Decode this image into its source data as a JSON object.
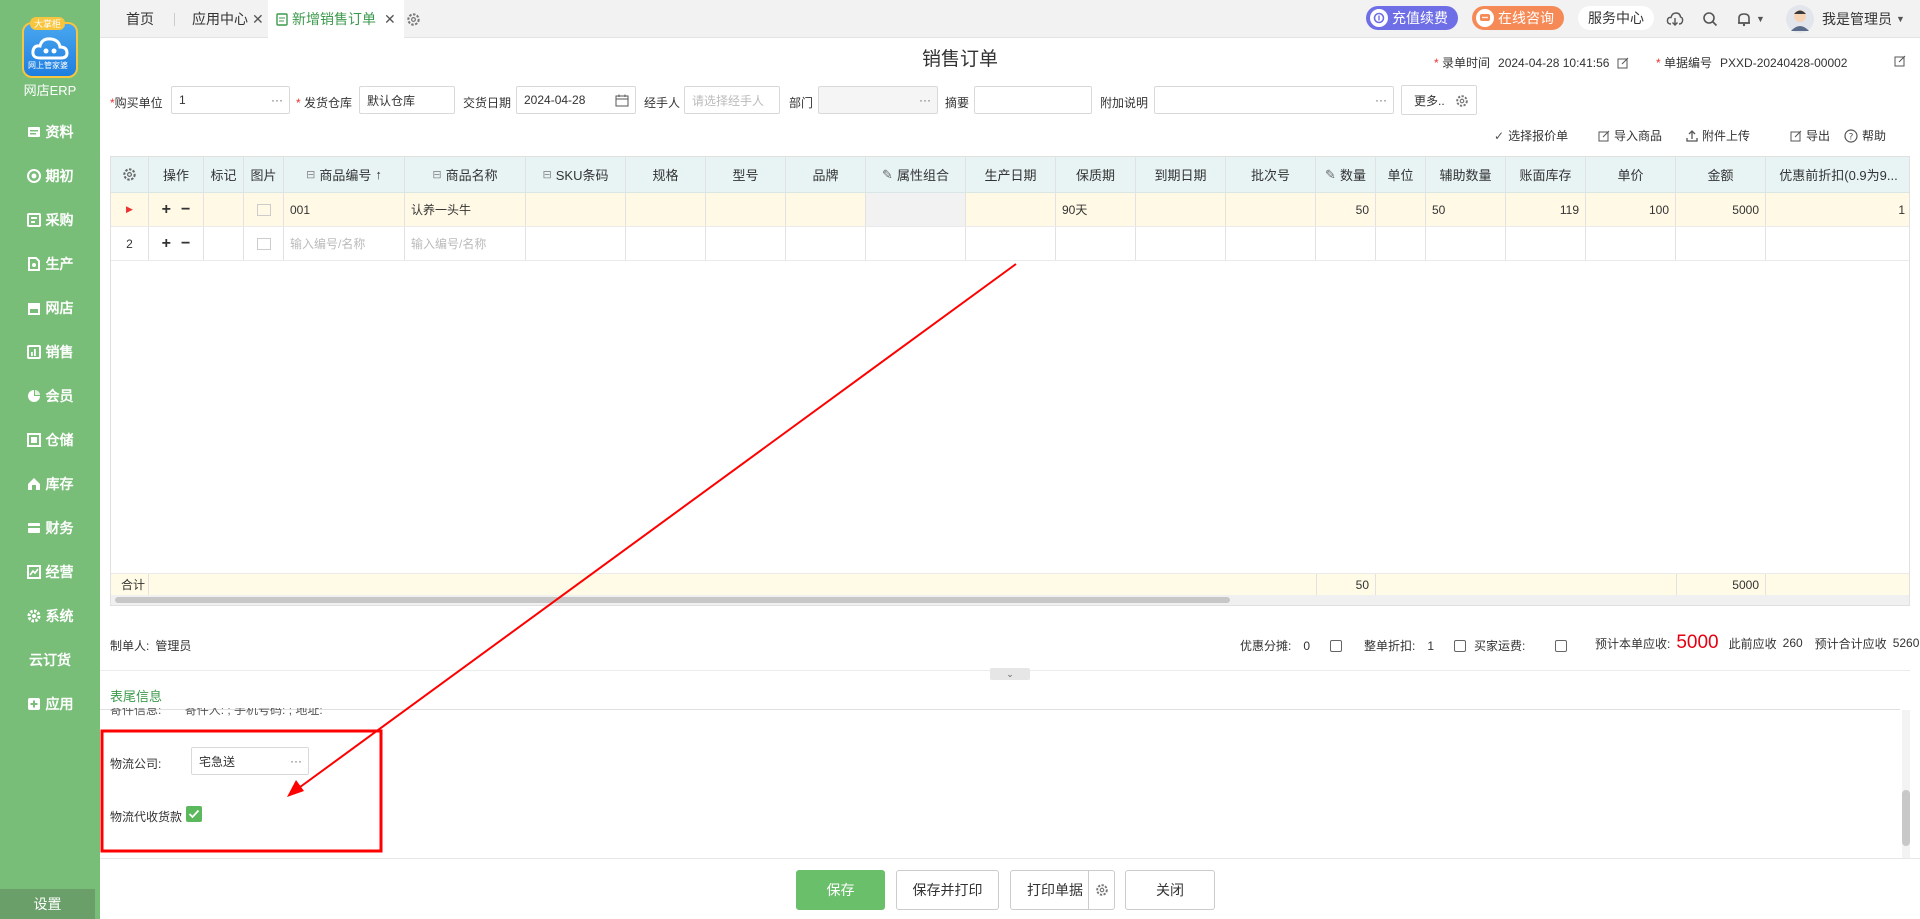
{
  "sidebar": {
    "logo_badge": "大掌柜",
    "logo_sub": "网上管家婆",
    "brand": "网店ERP",
    "items": [
      {
        "label": "资料",
        "icon": "folder-icon"
      },
      {
        "label": "期初",
        "icon": "target-icon"
      },
      {
        "label": "采购",
        "icon": "purchase-icon"
      },
      {
        "label": "生产",
        "icon": "production-icon"
      },
      {
        "label": "网店",
        "icon": "shop-icon"
      },
      {
        "label": "销售",
        "icon": "sales-chart-icon"
      },
      {
        "label": "会员",
        "icon": "member-pie-icon"
      },
      {
        "label": "仓储",
        "icon": "warehouse-icon"
      },
      {
        "label": "库存",
        "icon": "inventory-home-icon"
      },
      {
        "label": "财务",
        "icon": "finance-icon"
      },
      {
        "label": "经营",
        "icon": "business-chart-icon"
      },
      {
        "label": "系统",
        "icon": "system-gear-icon"
      },
      {
        "label": "云订货",
        "icon": ""
      },
      {
        "label": "应用",
        "icon": "app-plus-icon"
      }
    ],
    "settings_label": "设置"
  },
  "tabs": {
    "home": "首页",
    "app_center": "应用中心",
    "active": "新增销售订单"
  },
  "header": {
    "recharge": "充值续费",
    "consult": "在线咨询",
    "service": "服务中心",
    "user": "我是管理员"
  },
  "form": {
    "title": "销售订单",
    "entry_time_label": "录单时间",
    "entry_time": "2024-04-28 10:41:56",
    "doc_no_label": "单据编号",
    "doc_no": "PXXD-20240428-00002",
    "buyer_label": "购买单位",
    "buyer": "1",
    "warehouse_label": "发货仓库",
    "warehouse": "默认仓库",
    "date_label": "交货日期",
    "date": "2024-04-28",
    "handler_label": "经手人",
    "handler_placeholder": "请选择经手人",
    "dept_label": "部门",
    "summary_label": "摘要",
    "note_label": "附加说明",
    "more": "更多.."
  },
  "toolbar": {
    "select_quote": "选择报价单",
    "import_goods": "导入商品",
    "attach": "附件上传",
    "export": "导出",
    "help": "帮助"
  },
  "table": {
    "headers": [
      "操作",
      "标记",
      "图片",
      "商品编号",
      "商品名称",
      "SKU条码",
      "规格",
      "型号",
      "品牌",
      "属性组合",
      "生产日期",
      "保质期",
      "到期日期",
      "批次号",
      "数量",
      "单位",
      "辅助数量",
      "账面库存",
      "单价",
      "金额",
      "优惠前折扣(0.9为9..."
    ],
    "rows": [
      {
        "idx": "",
        "code": "001",
        "name": "认养一头牛",
        "shelf": "90天",
        "qty": "50",
        "aux_qty": "50",
        "stock": "119",
        "price": "100",
        "amount": "5000",
        "discount": "1"
      },
      {
        "idx": "2",
        "code_placeholder": "输入编号/名称",
        "name_placeholder": "输入编号/名称"
      }
    ],
    "footer": {
      "label": "合计",
      "qty": "50",
      "amount": "5000"
    }
  },
  "summary": {
    "maker_label": "制单人:",
    "maker": "管理员",
    "discount_share_label": "优惠分摊:",
    "discount_share": "0",
    "whole_discount_label": "整单折扣:",
    "whole_discount": "1",
    "buyer_freight_label": "买家运费:",
    "due_label": "预计本单应收:",
    "due": "5000",
    "prev_label": "此前应收",
    "prev": "260",
    "total_label": "预计合计应收",
    "total": "5260"
  },
  "tail": {
    "title": "表尾信息",
    "cut_text": "寄件信息:",
    "cut_text2": "寄件人: ; 手机号码: ; 地址:",
    "logistics_label": "物流公司:",
    "logistics": "宅急送",
    "cod_label": "物流代收货款"
  },
  "buttons": {
    "save": "保存",
    "save_print": "保存并打印",
    "print": "打印单据",
    "close": "关闭"
  },
  "colors": {
    "sidebar": "#78bd78",
    "accent": "#3c9a4c",
    "annotation": "#ff0000",
    "due_red": "#e60012"
  }
}
